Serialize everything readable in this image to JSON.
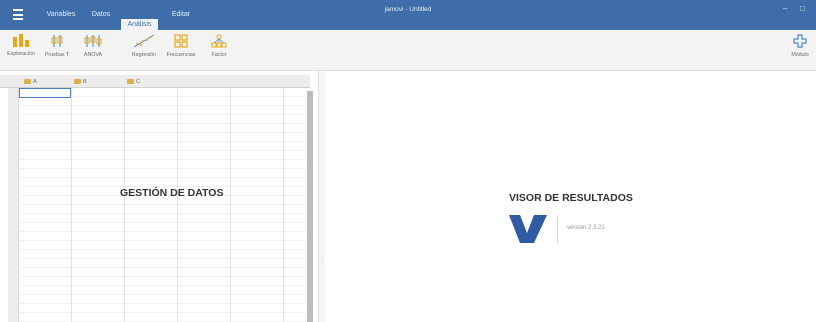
{
  "app": {
    "title": "jamovi - Untitled"
  },
  "menu": {
    "tabs": [
      {
        "label": "Variables"
      },
      {
        "label": "Datos"
      },
      {
        "label": "Análisis"
      },
      {
        "label": "Editar"
      }
    ],
    "active_tab": "Análisis"
  },
  "ribbon": {
    "buttons": [
      {
        "label": "Exploración",
        "icon": "exploration-icon"
      },
      {
        "label": "Pruebas T",
        "icon": "t-tests-icon"
      },
      {
        "label": "ANOVA",
        "icon": "anova-icon"
      },
      {
        "label": "Regresión",
        "icon": "regression-icon"
      },
      {
        "label": "Frecuencias",
        "icon": "frequencies-icon"
      },
      {
        "label": "Factor",
        "icon": "factor-icon"
      }
    ],
    "modules_label": "Módulo",
    "modules_icon": "plus-icon"
  },
  "spreadsheet": {
    "columns": [
      "A",
      "B",
      "C"
    ],
    "overlay_label": "GESTIÓN DE DATOS"
  },
  "results": {
    "overlay_label": "VISOR DE RESULTADOS",
    "version": "version 2.3.21"
  },
  "colors": {
    "titlebar": "#3e6da9",
    "ribbon_background": "#f3f3f3",
    "ribbon_icons": "#e6a817",
    "accent": "#3e6da9",
    "logo": "#2f5ba3"
  }
}
